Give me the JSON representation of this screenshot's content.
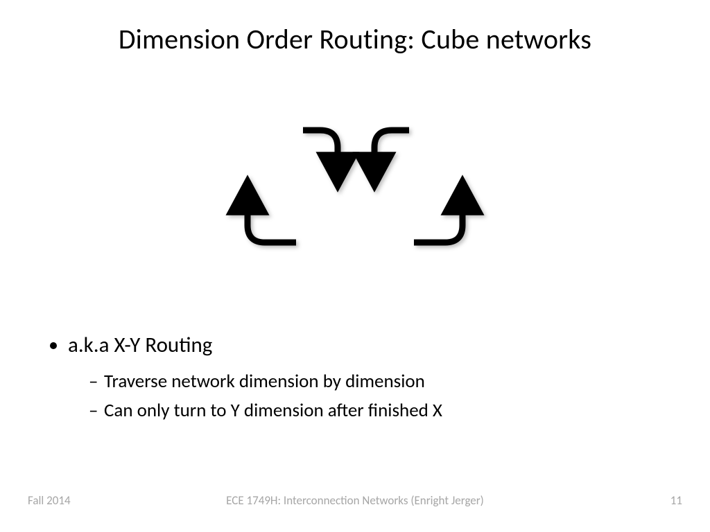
{
  "title": "Dimension Order Routing: Cube networks",
  "bullets": {
    "main": "a.k.a X-Y Routing",
    "sub1": "Traverse network dimension by dimension",
    "sub2": "Can only turn to Y dimension after finished X"
  },
  "footer": {
    "left": "Fall 2014",
    "center": "ECE 1749H: Interconnection Networks (Enright Jerger)",
    "right": "11"
  },
  "diagram": {
    "description": "Four curved arrows: two outer arrows (left and right) curving from horizontal inward then upward with arrowheads pointing up; two inner arrows starting from short horizontal stubs at top, curving down to meet in the middle with arrowheads pointing down."
  }
}
